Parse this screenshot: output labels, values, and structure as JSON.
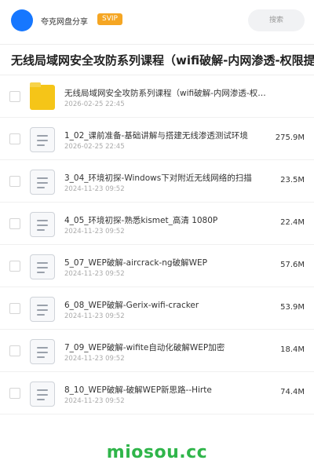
{
  "header": {
    "brand": "夸克网盘分享",
    "badge": "SVIP",
    "search_placeholder": "搜索"
  },
  "page_title": "无线局域网安全攻防系列课程（wifi破解-内网渗透-权限提升",
  "files": [
    {
      "type": "folder",
      "name": "无线局域网安全攻防系列课程（wifi破解-内网渗透-权限提升）",
      "date": "2026-02-25 22:45",
      "size": ""
    },
    {
      "type": "file",
      "name": "1_02_课前准备-基础讲解与搭建无线渗透测试环境",
      "date": "2026-02-25 22:45",
      "size": "275.9M"
    },
    {
      "type": "file",
      "name": "3_04_环境初探-Windows下对附近无线网络的扫描",
      "date": "2024-11-23 09:52",
      "size": "23.5M"
    },
    {
      "type": "file",
      "name": "4_05_环境初探-熟悉kismet_高清 1080P",
      "date": "2024-11-23 09:52",
      "size": "22.4M"
    },
    {
      "type": "file",
      "name": "5_07_WEP破解-aircrack-ng破解WEP",
      "date": "2024-11-23 09:52",
      "size": "57.6M"
    },
    {
      "type": "file",
      "name": "6_08_WEP破解-Gerix-wifi-cracker",
      "date": "2024-11-23 09:52",
      "size": "53.9M"
    },
    {
      "type": "file",
      "name": "7_09_WEP破解-wifite自动化破解WEP加密",
      "date": "2024-11-23 09:52",
      "size": "18.4M"
    },
    {
      "type": "file",
      "name": "8_10_WEP破解-破解WEP新思路--Hirte",
      "date": "2024-11-23 09:52",
      "size": "74.4M"
    }
  ],
  "watermark": "miosou.cc",
  "colors": {
    "accent": "#1677ff",
    "badge": "#f5a623",
    "folder": "#f5c518",
    "watermark": "#2fb54a"
  }
}
